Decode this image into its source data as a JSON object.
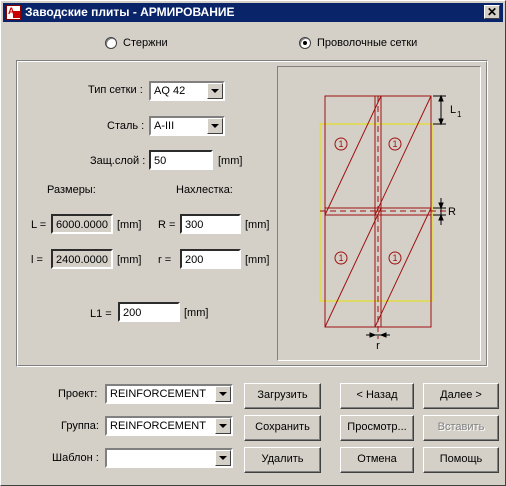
{
  "window": {
    "title": "Заводские плиты - АРМИРОВАНИЕ",
    "close_label": "✕"
  },
  "mode": {
    "option1": "Стержни",
    "option2": "Проволочные сетки",
    "selected": "option2"
  },
  "params": {
    "mesh_type_label": "Тип сетки :",
    "mesh_type_value": "AQ 42",
    "steel_label": "Сталь :",
    "steel_value": "A-III",
    "cover_label": "Защ.слой :",
    "cover_value": "50",
    "cover_unit": "[mm]",
    "dims_title": "Размеры:",
    "overlap_title": "Нахлестка:",
    "L_label": "L =",
    "L_value": "6000.0000",
    "L_unit": "[mm]",
    "l_label": "l =",
    "l_value": "2400.0000",
    "l_unit": "[mm]",
    "R_label": "R =",
    "R_value": "300",
    "R_unit": "[mm]",
    "r_label": "r =",
    "r_value": "200",
    "r_unit": "[mm]",
    "L1_label": "L1 =",
    "L1_value": "200",
    "L1_unit": "[mm]"
  },
  "diagram": {
    "label_L": "L",
    "label_L_sub": "1",
    "label_R": "R",
    "label_r": "r",
    "circle_num": "1",
    "colors": {
      "mesh": "#a01010",
      "overlap": "#e8e000",
      "dim": "#000000"
    }
  },
  "bottom": {
    "project_label": "Проект:",
    "project_value": "REINFORCEMENT",
    "group_label": "Группа:",
    "group_value": "REINFORCEMENT",
    "template_label": "Шаблон :",
    "template_value": "",
    "load": "Загрузить",
    "save": "Сохранить",
    "delete": "Удалить",
    "back": "< Назад",
    "next": "Далее >",
    "preview": "Просмотр...",
    "insert": "Вставить",
    "cancel": "Отмена",
    "help": "Помощь"
  }
}
